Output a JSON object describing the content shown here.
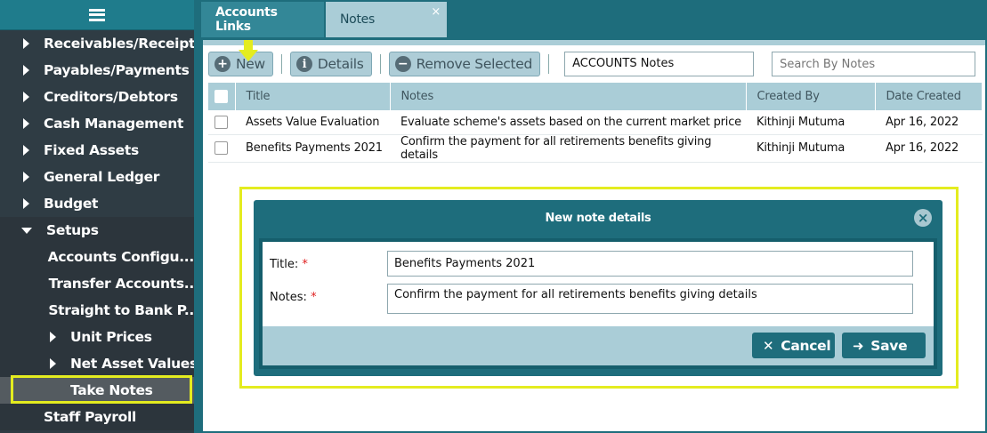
{
  "sidebar": {
    "items": [
      {
        "label": "Receivables/Receipts",
        "arrow": "right",
        "level": 1
      },
      {
        "label": "Payables/Payments",
        "arrow": "right",
        "level": 1
      },
      {
        "label": "Creditors/Debtors",
        "arrow": "right",
        "level": 1
      },
      {
        "label": "Cash Management",
        "arrow": "right",
        "level": 1
      },
      {
        "label": "Fixed Assets",
        "arrow": "right",
        "level": 1
      },
      {
        "label": "General Ledger",
        "arrow": "right",
        "level": 1
      },
      {
        "label": "Budget",
        "arrow": "right",
        "level": 1
      },
      {
        "label": "Setups",
        "arrow": "down",
        "level": 1
      },
      {
        "label": "Accounts Configu...",
        "arrow": "none",
        "level": 2
      },
      {
        "label": "Transfer Accounts..",
        "arrow": "none",
        "level": 2
      },
      {
        "label": "Straight to Bank P..",
        "arrow": "none",
        "level": 2
      },
      {
        "label": "Unit Prices",
        "arrow": "right",
        "level": 2
      },
      {
        "label": "Net Asset Values",
        "arrow": "right",
        "level": 2
      },
      {
        "label": "Take Notes",
        "arrow": "none",
        "level": 2,
        "selected": true
      },
      {
        "label": "Staff Payroll",
        "arrow": "none",
        "level": 1
      }
    ]
  },
  "tabs": [
    {
      "label": "Accounts Links",
      "active": false
    },
    {
      "label": "Notes",
      "active": true,
      "close": "×"
    }
  ],
  "toolbar": {
    "new_label": "New",
    "details_label": "Details",
    "remove_label": "Remove Selected",
    "account_value": "ACCOUNTS Notes",
    "search_placeholder": "Search By Notes"
  },
  "table": {
    "columns": [
      "Title",
      "Notes",
      "Created By",
      "Date Created"
    ],
    "rows": [
      {
        "title": "Assets Value Evaluation",
        "notes": "Evaluate scheme's assets based on the current market price",
        "created_by": "Kithinji Mutuma",
        "date": "Apr 16, 2022"
      },
      {
        "title": "Benefits Payments 2021",
        "notes": "Confirm the payment for all retirements benefits giving details",
        "created_by": "Kithinji Mutuma",
        "date": "Apr 16, 2022"
      }
    ]
  },
  "dialog": {
    "title": "New note details",
    "title_label": "Title:",
    "notes_label": "Notes:",
    "required_mark": "*",
    "title_value": "Benefits Payments 2021",
    "notes_value": "Confirm the payment for all retirements benefits giving details",
    "cancel_label": "Cancel",
    "save_label": "Save"
  },
  "colors": {
    "sidebar_bg": "#2f3c44",
    "accent": "#1e6d7c",
    "light_accent": "#aacdd7",
    "highlight": "#e4ec1f"
  }
}
